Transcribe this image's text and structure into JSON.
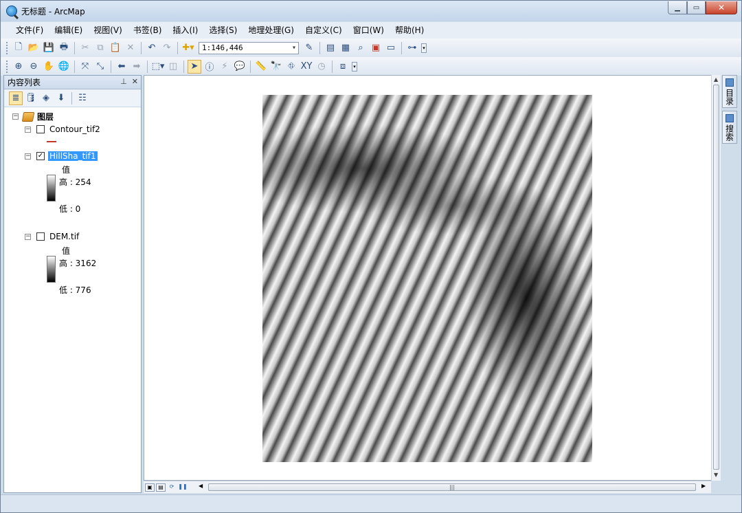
{
  "window": {
    "title": "无标题 - ArcMap"
  },
  "menubar": {
    "items": [
      "文件(F)",
      "编辑(E)",
      "视图(V)",
      "书签(B)",
      "插入(I)",
      "选择(S)",
      "地理处理(G)",
      "自定义(C)",
      "窗口(W)",
      "帮助(H)"
    ]
  },
  "toolbar": {
    "scale": "1:146,446"
  },
  "toc": {
    "title": "内容列表",
    "root_label": "图层",
    "layers": [
      {
        "name": "Contour_tif2",
        "checked": false
      },
      {
        "name": "HillSha_tif1",
        "checked": true,
        "value_label": "值",
        "high": "高 : 254",
        "low": "低 : 0"
      },
      {
        "name": "DEM.tif",
        "checked": false,
        "value_label": "值",
        "high": "高 : 3162",
        "low": "低 : 776"
      }
    ]
  },
  "side_tabs": [
    "目录",
    "搜索"
  ],
  "colors": {
    "selection": "#3399ff",
    "contour_line": "#c0392b"
  }
}
